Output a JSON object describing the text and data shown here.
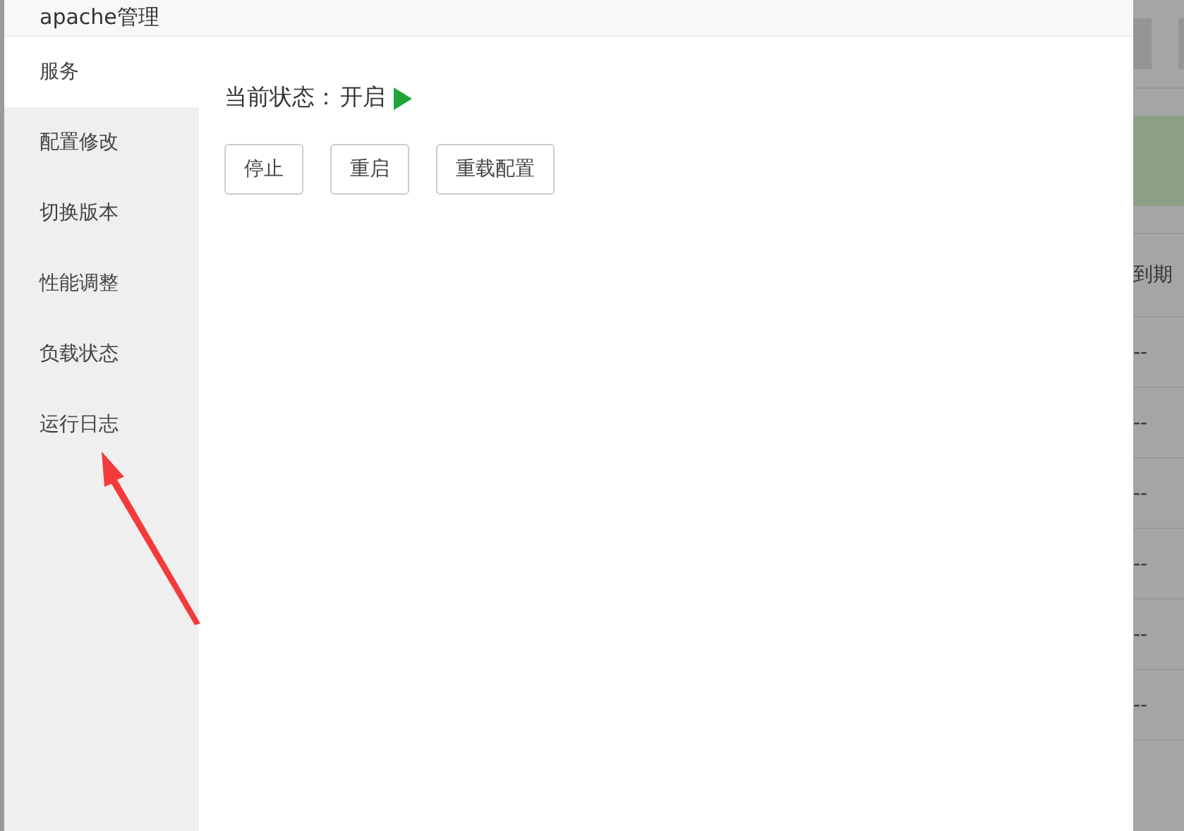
{
  "dialog": {
    "title": "apache管理"
  },
  "sidebar": {
    "items": [
      {
        "label": "服务",
        "selected": true
      },
      {
        "label": "配置修改",
        "selected": false
      },
      {
        "label": "切换版本",
        "selected": false
      },
      {
        "label": "性能调整",
        "selected": false
      },
      {
        "label": "负载状态",
        "selected": false
      },
      {
        "label": "运行日志",
        "selected": false
      }
    ]
  },
  "service": {
    "status_label": "当前状态：",
    "status_value": "开启",
    "running": true,
    "buttons": [
      "停止",
      "重启",
      "重载配置"
    ]
  },
  "background_table": {
    "column_header": "到期",
    "cells": [
      "--",
      "--",
      "--",
      "--",
      "--",
      "--"
    ]
  }
}
